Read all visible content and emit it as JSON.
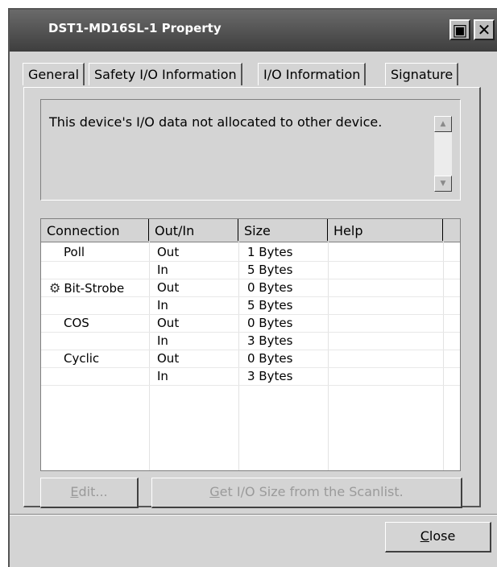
{
  "window": {
    "title": "DST1-MD16SL-1 Property",
    "restore_glyph": "▣",
    "close_glyph": "✕"
  },
  "tabs": [
    {
      "label": "General",
      "active": false
    },
    {
      "label": "Safety I/O Information",
      "active": false
    },
    {
      "label": "I/O Information",
      "active": true
    },
    {
      "label": "Signature",
      "active": false
    }
  ],
  "message": "This device's I/O data not allocated to other device.",
  "scroll": {
    "up_icon": "▲",
    "down_icon": "▼"
  },
  "table": {
    "headers": [
      "Connection",
      "Out/In",
      "Size",
      "Help"
    ],
    "rows": [
      {
        "connection": "Poll",
        "icon": "",
        "dir": "Out",
        "size": "1 Bytes"
      },
      {
        "connection": "",
        "icon": "",
        "dir": "In",
        "size": "5 Bytes"
      },
      {
        "connection": "Bit-Strobe",
        "icon": "lightbulb-icon",
        "dir": "Out",
        "size": "0 Bytes"
      },
      {
        "connection": "",
        "icon": "",
        "dir": "In",
        "size": "5 Bytes"
      },
      {
        "connection": "COS",
        "icon": "",
        "dir": "Out",
        "size": "0 Bytes"
      },
      {
        "connection": "",
        "icon": "",
        "dir": "In",
        "size": "3 Bytes"
      },
      {
        "connection": "Cyclic",
        "icon": "",
        "dir": "Out",
        "size": "0 Bytes"
      },
      {
        "connection": "",
        "icon": "",
        "dir": "In",
        "size": "3 Bytes"
      }
    ]
  },
  "buttons": {
    "edit": "Edit...",
    "get_size": "Get I/O Size from the Scanlist.",
    "close": "Close"
  }
}
